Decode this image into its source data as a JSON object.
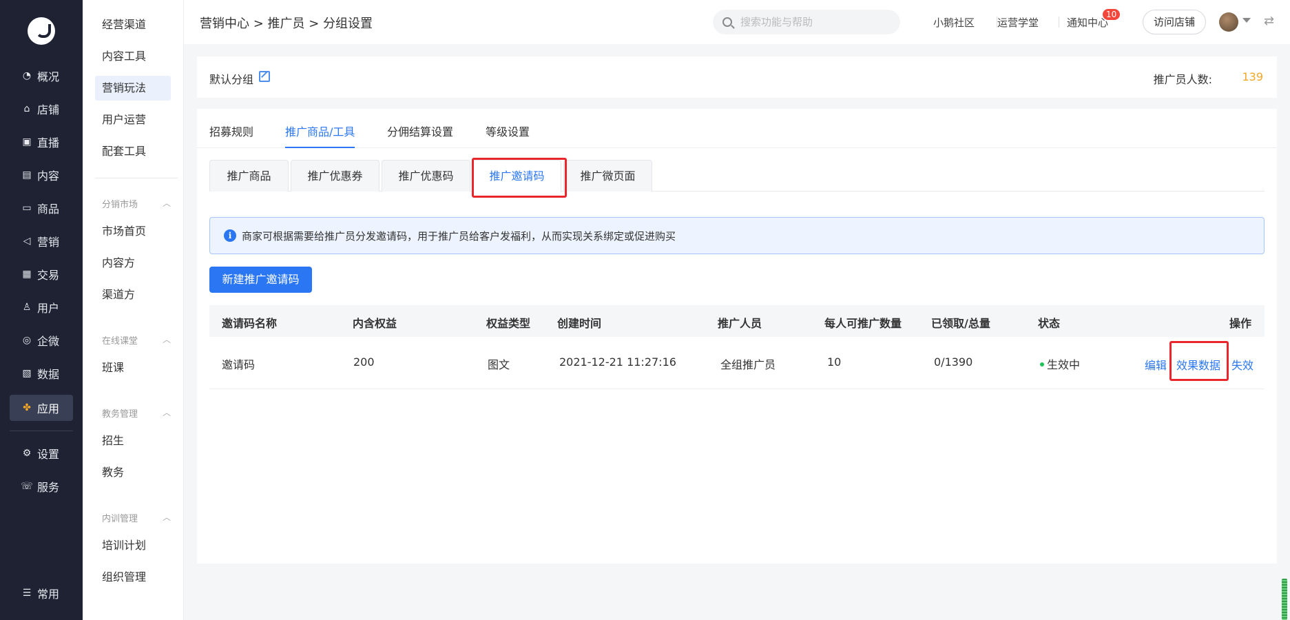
{
  "nav": {
    "items": [
      {
        "label": "概况",
        "icon": "pie-chart-icon"
      },
      {
        "label": "店铺",
        "icon": "store-icon"
      },
      {
        "label": "直播",
        "icon": "live-icon"
      },
      {
        "label": "内容",
        "icon": "document-icon"
      },
      {
        "label": "商品",
        "icon": "box-icon"
      },
      {
        "label": "营销",
        "icon": "megaphone-icon"
      },
      {
        "label": "交易",
        "icon": "transaction-icon"
      },
      {
        "label": "用户",
        "icon": "user-icon"
      },
      {
        "label": "企微",
        "icon": "wecom-icon"
      },
      {
        "label": "数据",
        "icon": "data-icon"
      },
      {
        "label": "应用",
        "icon": "apps-icon"
      },
      {
        "label": "设置",
        "icon": "gear-icon"
      },
      {
        "label": "服务",
        "icon": "service-icon"
      },
      {
        "label": "常用",
        "icon": "list-icon"
      }
    ]
  },
  "submenu": {
    "items": [
      "经营渠道",
      "内容工具",
      "营销玩法",
      "用户运营",
      "配套工具"
    ],
    "group1": {
      "title": "分销市场",
      "items": [
        "市场首页",
        "内容方",
        "渠道方"
      ]
    },
    "group2": {
      "title": "在线课堂",
      "items": [
        "班课"
      ]
    },
    "group3": {
      "title": "教务管理",
      "items": [
        "招生",
        "教务"
      ]
    },
    "group4": {
      "title": "内训管理",
      "items": [
        "培训计划",
        "组织管理"
      ]
    }
  },
  "header": {
    "breadcrumb": "营销中心 > 推广员 > 分组设置",
    "search_placeholder": "搜索功能与帮助",
    "community": "小鹅社区",
    "academy": "运营学堂",
    "notifications": "通知中心",
    "notification_count": "10",
    "visit_store": "访问店铺"
  },
  "group": {
    "name": "默认分组",
    "count_label": "推广员人数:",
    "count_value": "139"
  },
  "tabs": [
    "招募规则",
    "推广商品/工具",
    "分佣结算设置",
    "等级设置"
  ],
  "subtabs": [
    "推广商品",
    "推广优惠券",
    "推广优惠码",
    "推广邀请码",
    "推广微页面"
  ],
  "notice": "商家可根据需要给推广员分发邀请码，用于推广员给客户发福利，从而实现关系绑定或促进购买",
  "new_button": "新建推广邀请码",
  "table": {
    "headers": [
      "邀请码名称",
      "内含权益",
      "权益类型",
      "创建时间",
      "推广人员",
      "每人可推广数量",
      "已领取/总量",
      "状态",
      "操作"
    ],
    "rows": [
      {
        "name": "邀请码",
        "benefit": "200",
        "type": "图文",
        "created": "2021-12-21 11:27:16",
        "promoters": "全组推广员",
        "per_person": "10",
        "claimed": "0/1390",
        "status": "生效中",
        "actions": [
          "编辑",
          "效果数据",
          "失效"
        ]
      }
    ]
  },
  "colors": {
    "accent": "#2b77f3",
    "highlight": "#e8262b",
    "count": "#f5a623",
    "status_active": "#1fc15a",
    "nav_bg": "#1e2232"
  }
}
